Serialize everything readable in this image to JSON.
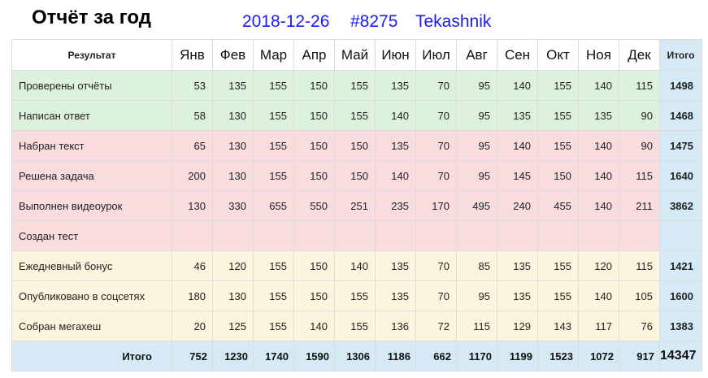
{
  "header": {
    "title": "Отчёт за год",
    "date": "2018-12-26",
    "number": "#8275",
    "user": "Tekashnik"
  },
  "table": {
    "label_header": "Результат",
    "total_header": "Итого",
    "months": [
      "Янв",
      "Фев",
      "Мар",
      "Апр",
      "Май",
      "Июн",
      "Июл",
      "Авг",
      "Сен",
      "Окт",
      "Ноя",
      "Дек"
    ],
    "rows": [
      {
        "group": "g1",
        "label": "Проверены отчёты",
        "values": [
          "53",
          "135",
          "155",
          "150",
          "155",
          "135",
          "70",
          "95",
          "140",
          "155",
          "140",
          "115"
        ],
        "total": "1498"
      },
      {
        "group": "g1",
        "label": "Написан ответ",
        "values": [
          "58",
          "130",
          "155",
          "150",
          "155",
          "140",
          "70",
          "95",
          "135",
          "155",
          "135",
          "90"
        ],
        "total": "1468"
      },
      {
        "group": "g2",
        "label": "Набран текст",
        "values": [
          "65",
          "130",
          "155",
          "150",
          "150",
          "135",
          "70",
          "95",
          "140",
          "155",
          "140",
          "90"
        ],
        "total": "1475"
      },
      {
        "group": "g2",
        "label": "Решена задача",
        "values": [
          "200",
          "130",
          "155",
          "150",
          "150",
          "140",
          "70",
          "95",
          "145",
          "150",
          "140",
          "115"
        ],
        "total": "1640"
      },
      {
        "group": "g2",
        "label": "Выполнен видеоурок",
        "values": [
          "130",
          "330",
          "655",
          "550",
          "251",
          "235",
          "170",
          "495",
          "240",
          "455",
          "140",
          "211"
        ],
        "total": "3862"
      },
      {
        "group": "g2",
        "label": "Создан тест",
        "values": [
          "",
          "",
          "",
          "",
          "",
          "",
          "",
          "",
          "",
          "",
          "",
          ""
        ],
        "total": ""
      },
      {
        "group": "g3",
        "label": "Ежедневный бонус",
        "values": [
          "46",
          "120",
          "155",
          "150",
          "140",
          "135",
          "70",
          "85",
          "135",
          "155",
          "120",
          "115"
        ],
        "total": "1421"
      },
      {
        "group": "g3",
        "label": "Опубликовано в соцсетях",
        "values": [
          "180",
          "130",
          "155",
          "150",
          "155",
          "135",
          "70",
          "95",
          "135",
          "155",
          "140",
          "105"
        ],
        "total": "1600"
      },
      {
        "group": "g3",
        "label": "Собран мегахеш",
        "values": [
          "20",
          "125",
          "155",
          "140",
          "155",
          "136",
          "72",
          "115",
          "129",
          "143",
          "117",
          "76"
        ],
        "total": "1383"
      }
    ],
    "footer": {
      "label": "Итого",
      "values": [
        "752",
        "1230",
        "1740",
        "1590",
        "1306",
        "1186",
        "662",
        "1170",
        "1199",
        "1523",
        "1072",
        "917"
      ],
      "grand_total": "14347"
    }
  }
}
